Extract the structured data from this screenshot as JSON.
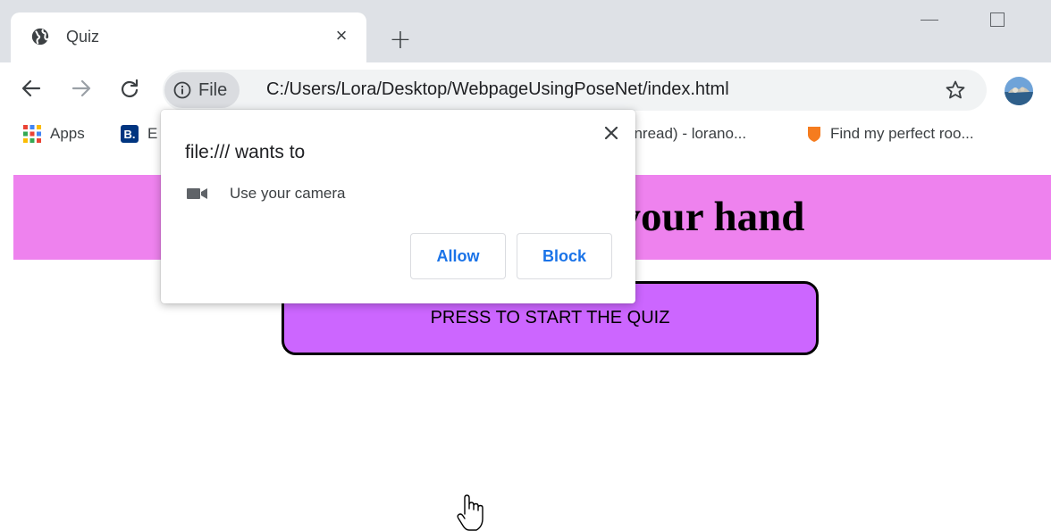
{
  "window": {
    "tab_title": "Quiz",
    "tab_close": "×",
    "new_tab": "+"
  },
  "toolbar": {
    "site_chip": "File",
    "url": "C:/Users/Lora/Desktop/WebpageUsingPoseNet/index.html"
  },
  "bookmarks": [
    {
      "label": "Apps",
      "icon": "apps-grid-icon"
    },
    {
      "label": "E",
      "icon": "booking-icon",
      "icon_letter": "B."
    },
    {
      "label": "unread) - lorano...",
      "icon": "mail-icon"
    },
    {
      "label": "Find my perfect roo...",
      "icon": "shield-icon",
      "icon_color": "#f57c1f"
    }
  ],
  "page": {
    "banner_title": "Answer by moving your hand",
    "banner_color": "#ee82ee",
    "start_button": "PRESS TO START THE QUIZ",
    "start_button_color": "#cc66ff"
  },
  "permission_popup": {
    "title": "file:/// wants to",
    "permission": "Use your camera",
    "allow_label": "Allow",
    "block_label": "Block",
    "accent_color": "#1a73e8"
  }
}
